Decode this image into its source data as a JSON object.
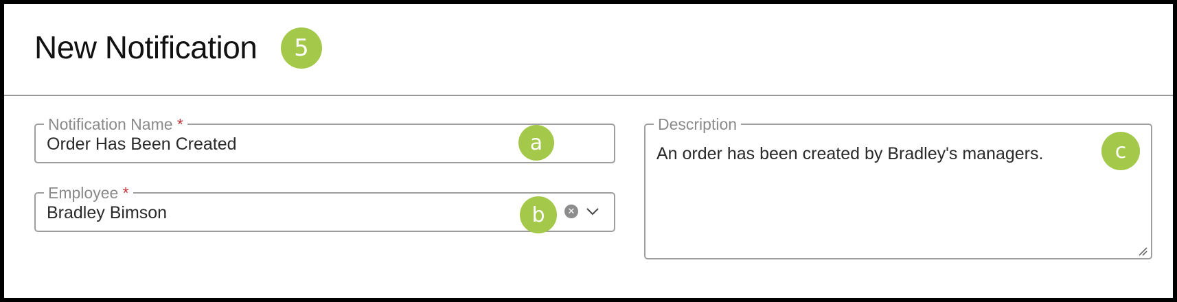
{
  "header": {
    "title": "New Notification",
    "step_badge": "5"
  },
  "form": {
    "notification_name": {
      "label": "Notification Name",
      "required_mark": "*",
      "value": "Order Has Been Created",
      "badge": "a"
    },
    "employee": {
      "label": "Employee",
      "required_mark": "*",
      "value": "Bradley Bimson",
      "badge": "b",
      "clear_icon": "clear-icon",
      "dropdown_icon": "chevron-down-icon"
    },
    "description": {
      "label": "Description",
      "value": "An order has been created by Bradley's managers.",
      "badge": "c",
      "resize_icon": "resize-handle-icon"
    }
  },
  "colors": {
    "badge": "#a3c84a",
    "required": "#c2323a",
    "border": "#9e9e9e"
  }
}
